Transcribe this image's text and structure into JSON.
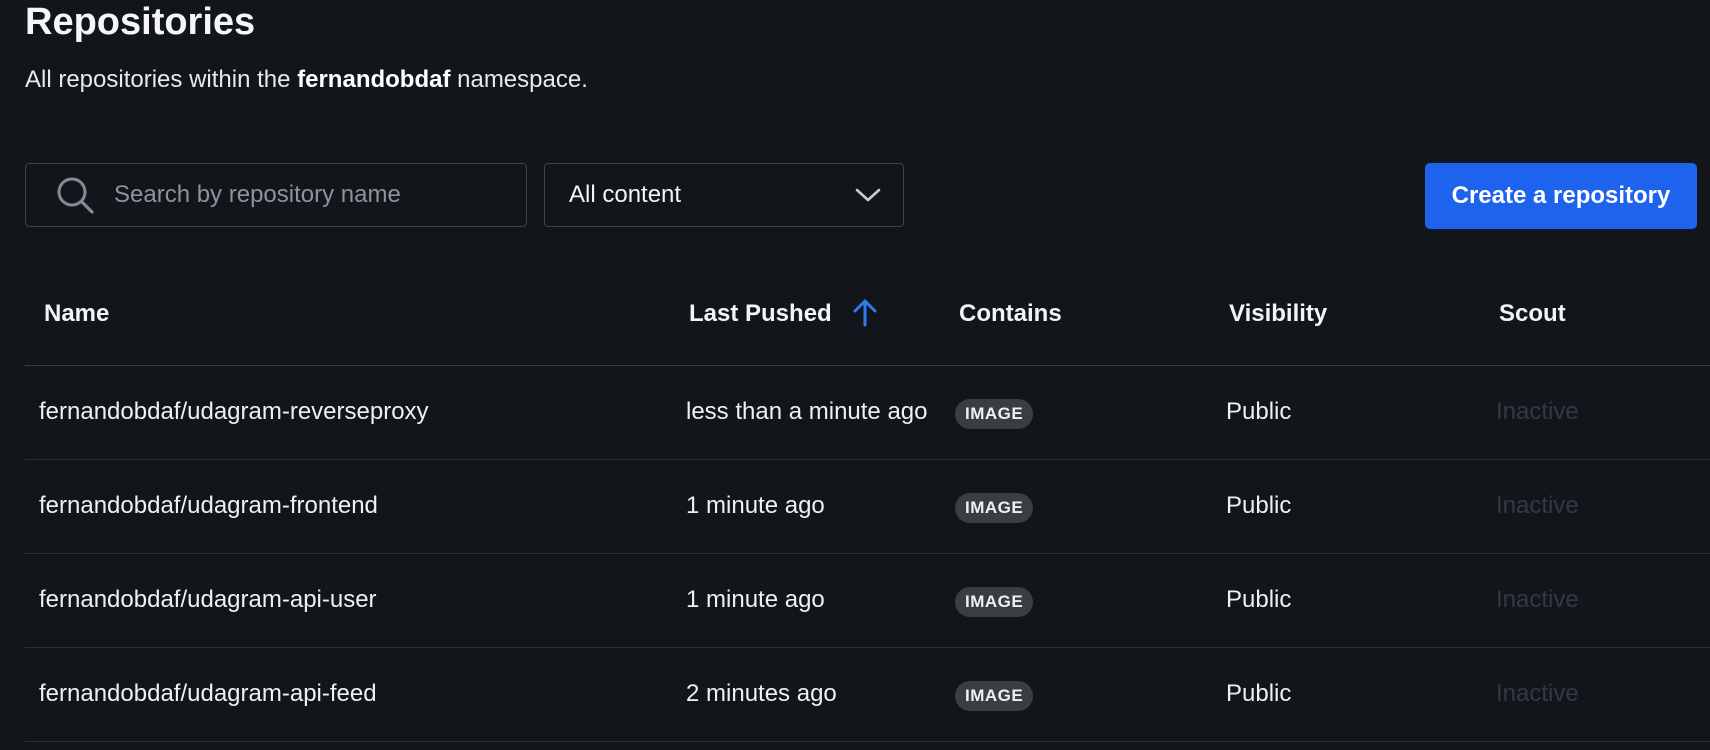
{
  "header": {
    "title": "Repositories",
    "subtitle_prefix": "All repositories within the ",
    "namespace": "fernandobdaf",
    "subtitle_suffix": " namespace."
  },
  "toolbar": {
    "search_placeholder": "Search by repository name",
    "search_value": "",
    "filter_value": "All content",
    "create_label": "Create a repository",
    "accent_color": "#1d63ed"
  },
  "table": {
    "columns": [
      "Name",
      "Last Pushed",
      "Contains",
      "Visibility",
      "Scout"
    ],
    "sort": {
      "column": "Last Pushed",
      "direction": "ascending",
      "icon": "arrow-up-icon"
    },
    "rows": [
      {
        "name": "fernandobdaf/udagram-reverseproxy",
        "last_pushed": "less than a minute ago",
        "contains": "IMAGE",
        "visibility": "Public",
        "scout": "Inactive"
      },
      {
        "name": "fernandobdaf/udagram-frontend",
        "last_pushed": "1 minute ago",
        "contains": "IMAGE",
        "visibility": "Public",
        "scout": "Inactive"
      },
      {
        "name": "fernandobdaf/udagram-api-user",
        "last_pushed": "1 minute ago",
        "contains": "IMAGE",
        "visibility": "Public",
        "scout": "Inactive"
      },
      {
        "name": "fernandobdaf/udagram-api-feed",
        "last_pushed": "2 minutes ago",
        "contains": "IMAGE",
        "visibility": "Public",
        "scout": "Inactive"
      }
    ]
  }
}
